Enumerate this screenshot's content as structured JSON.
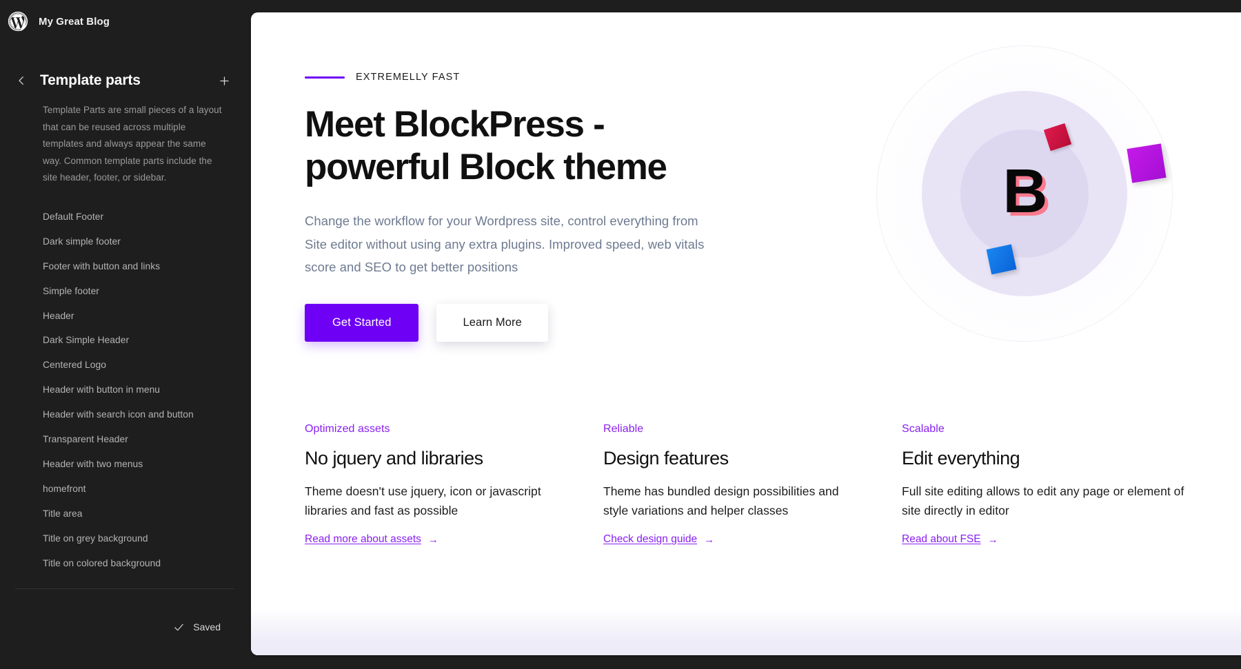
{
  "sidebar": {
    "site_title": "My Great Blog",
    "logo_icon": "wordpress-icon",
    "back_icon": "chevron-left-icon",
    "add_icon": "plus-icon",
    "panel_title": "Template parts",
    "panel_description": "Template Parts are small pieces of a layout that can be reused across multiple templates and always appear the same way. Common template parts include the site header, footer, or sidebar.",
    "items": [
      {
        "label": "Default Footer"
      },
      {
        "label": "Dark simple footer"
      },
      {
        "label": "Footer with button and links"
      },
      {
        "label": "Simple footer"
      },
      {
        "label": "Header"
      },
      {
        "label": "Dark Simple Header"
      },
      {
        "label": "Centered Logo"
      },
      {
        "label": "Header with button in menu"
      },
      {
        "label": "Header with search icon and button"
      },
      {
        "label": "Transparent Header"
      },
      {
        "label": "Header with two menus"
      },
      {
        "label": "homefront"
      },
      {
        "label": "Title area"
      },
      {
        "label": "Title on grey background"
      },
      {
        "label": "Title on colored background"
      }
    ],
    "status": {
      "check_icon": "checkmark-icon",
      "label": "Saved"
    }
  },
  "canvas": {
    "hero": {
      "eyebrow": "EXTREMELLY FAST",
      "title": "Meet BlockPress - powerful Block theme",
      "subtitle": "Change the workflow for your Wordpress site, control everything from Site editor without using any extra plugins. Improved speed, web vitals score and SEO to get better positions",
      "primary_button": "Get Started",
      "secondary_button": "Learn More",
      "art": {
        "letter": "B",
        "shape_red": "rotated-square-red",
        "shape_purple": "rotated-square-purple",
        "shape_blue": "rotated-square-blue"
      }
    },
    "features": [
      {
        "tag": "Optimized assets",
        "title": "No jquery and libraries",
        "description": "Theme doesn't use jquery, icon or javascript libraries and fast as possible",
        "link": "Read more about assets",
        "arrow": "→"
      },
      {
        "tag": "Reliable",
        "title": "Design features",
        "description": "Theme has bundled design possibilities and style variations and helper classes",
        "link": "Check design guide",
        "arrow": "→"
      },
      {
        "tag": "Scalable",
        "title": "Edit everything",
        "description": "Full site editing allows to edit any page or element of site directly in editor",
        "link": "Read about FSE",
        "arrow": "→"
      }
    ]
  },
  "colors": {
    "sidebar_bg": "#1e1e1e",
    "accent_purple": "#6d00f5",
    "link_purple": "#8a20f0",
    "canvas_bg": "#ffffff"
  }
}
